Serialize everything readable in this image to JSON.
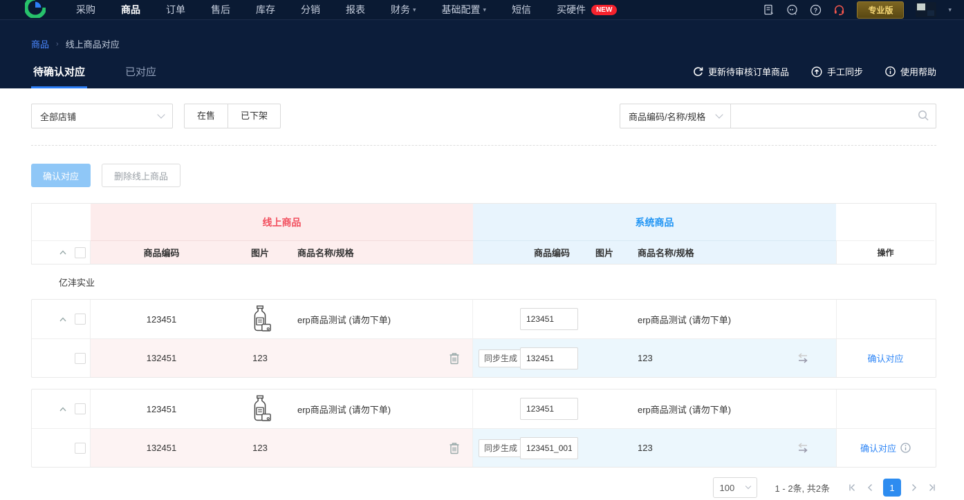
{
  "nav": {
    "items": [
      "采购",
      "商品",
      "订单",
      "售后",
      "库存",
      "分销",
      "报表",
      "财务",
      "基础配置",
      "短信",
      "买硬件"
    ],
    "new_badge": "NEW",
    "pro_label": "专业版"
  },
  "breadcrumb": {
    "root": "商品",
    "current": "线上商品对应"
  },
  "tabs": {
    "pending": "待确认对应",
    "matched": "已对应"
  },
  "header_actions": {
    "refresh": "更新待审核订单商品",
    "manual_sync": "手工同步",
    "help": "使用帮助"
  },
  "filters": {
    "shop_select": "全部店铺",
    "on_sale": "在售",
    "off_shelf": "已下架",
    "search_type": "商品编码/名称/规格",
    "search_value": ""
  },
  "toolbar": {
    "confirm": "确认对应",
    "delete_online": "删除线上商品"
  },
  "table": {
    "online_header": "线上商品",
    "system_header": "系统商品",
    "sub_headers": {
      "code": "商品编码",
      "image": "图片",
      "name_spec": "商品名称/规格",
      "action": "操作"
    },
    "group_name": "亿沣实业",
    "sync_button": "同步生成",
    "confirm_link": "确认对应",
    "groups": [
      {
        "main": {
          "online_code": "123451",
          "online_name": "erp商品测试 (请勿下单)",
          "system_code_input": "123451",
          "system_name": "erp商品测试 (请勿下单)"
        },
        "sub": {
          "online_code": "132451",
          "online_name": "123",
          "system_code_input": "132451",
          "system_name": "123",
          "has_info": false
        }
      },
      {
        "main": {
          "online_code": "123451",
          "online_name": "erp商品测试 (请勿下单)",
          "system_code_input": "123451",
          "system_name": "erp商品测试 (请勿下单)"
        },
        "sub": {
          "online_code": "132451",
          "online_name": "123",
          "system_code_input": "123451_001",
          "system_name": "123",
          "has_info": true
        }
      }
    ]
  },
  "pagination": {
    "page_size": "100",
    "range_text": "1 - 2条, 共2条",
    "current_page": "1"
  },
  "colors": {
    "nav_bg": "#0a1a33",
    "accent_blue": "#2d7ff7",
    "online_red": "#f24f5e",
    "system_blue": "#1f94f4",
    "badge_red": "#f5222d",
    "pro_gold": "#f6d876"
  }
}
